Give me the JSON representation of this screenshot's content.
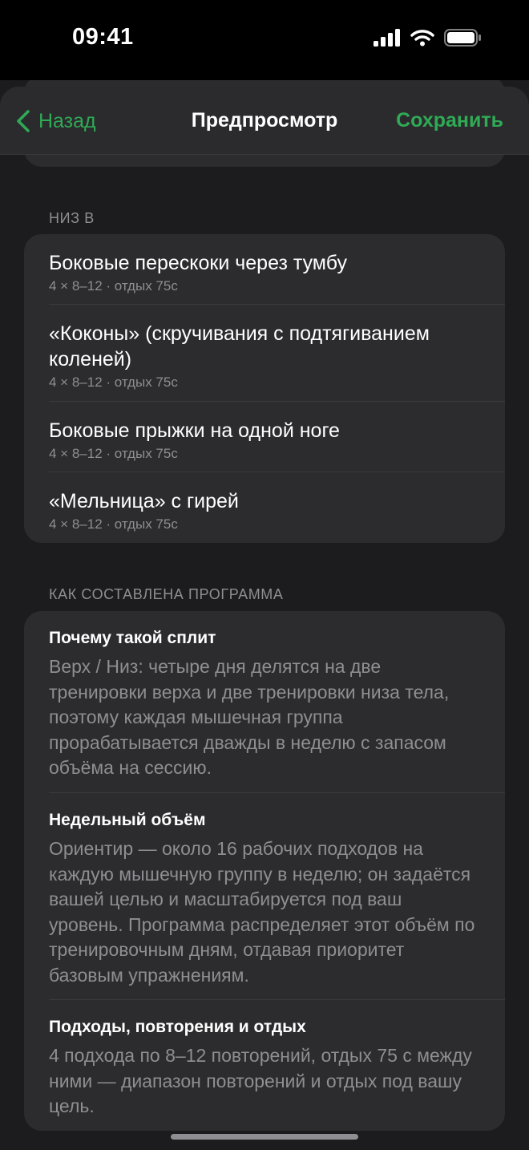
{
  "status_bar": {
    "time": "09:41",
    "icons": [
      "signal-icon",
      "wifi-icon",
      "battery-icon"
    ]
  },
  "nav": {
    "back_label": "Назад",
    "title": "Предпросмотр",
    "save_label": "Сохранить",
    "accent_color": "#2faa55"
  },
  "lower_b": {
    "header": "НИЗ В",
    "exercises": [
      {
        "title": "Боковые перескоки через тумбу",
        "meta": "4 × 8–12 · отдых 75с"
      },
      {
        "title": "«Коконы» (скручивания с подтягиванием коленей)",
        "meta": "4 × 8–12 · отдых 75с"
      },
      {
        "title": "Боковые прыжки на одной ноге",
        "meta": "4 × 8–12 · отдых 75с"
      },
      {
        "title": "«Мельница» с гирей",
        "meta": "4 × 8–12 · отдых 75с"
      }
    ]
  },
  "program_info": {
    "header": "КАК СОСТАВЛЕНА ПРОГРАММА",
    "blocks": [
      {
        "title": "Почему такой сплит",
        "body": "Верх / Низ: четыре дня делятся на две тренировки верха и две тренировки низа тела, поэтому каждая мышечная группа прорабатывается дважды в неделю с запасом объёма на сессию."
      },
      {
        "title": "Недельный объём",
        "body": "Ориентир — около 16 рабочих подходов на каждую мышечную группу в неделю; он задаётся вашей целью и масштабируется под ваш уровень. Программа распределяет этот объём по тренировочным дням, отдавая приоритет базовым упражнениям."
      },
      {
        "title": "Подходы, повторения и отдых",
        "body": "4 подхода по 8–12 повторений, отдых 75 с между ними — диапазон повторений и отдых под вашу цель."
      }
    ]
  }
}
